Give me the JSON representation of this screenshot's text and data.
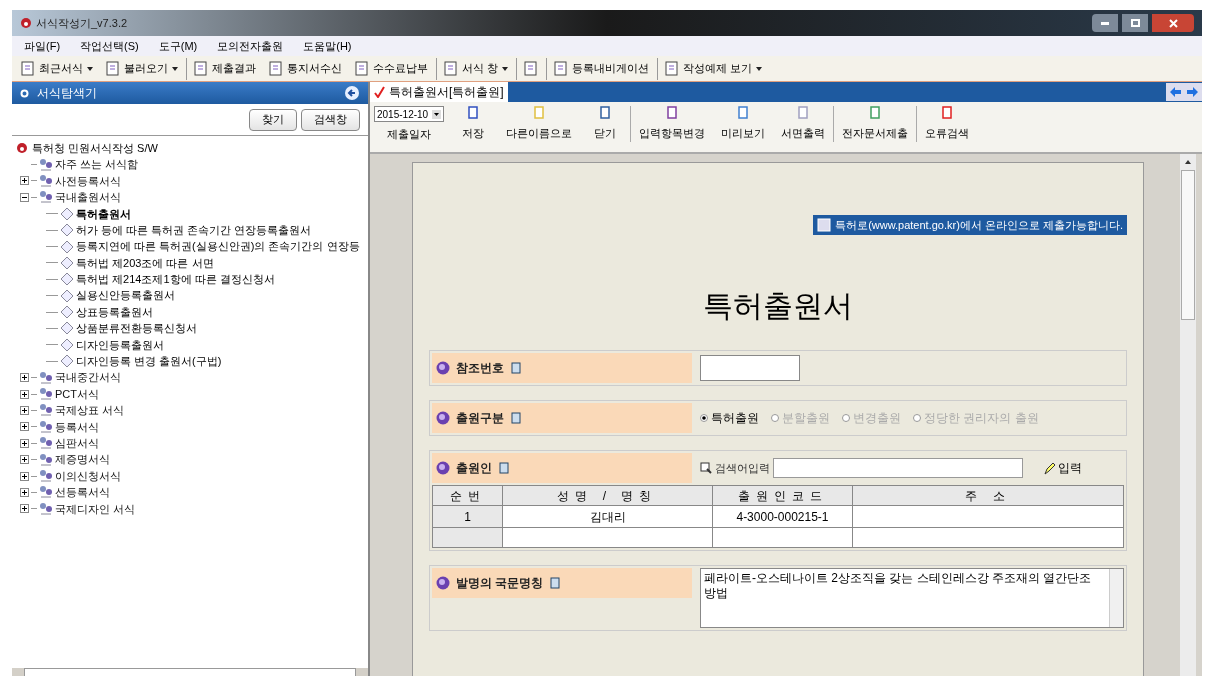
{
  "window": {
    "title": "서식작성기_v7.3.2"
  },
  "menu": [
    "파일(F)",
    "작업선택(S)",
    "도구(M)",
    "모의전자출원",
    "도움말(H)"
  ],
  "toolbar": [
    {
      "label": "최근서식",
      "dropdown": true,
      "separator_before": false
    },
    {
      "label": "불러오기",
      "dropdown": true,
      "separator_before": false
    },
    {
      "label": "제출결과",
      "dropdown": false,
      "separator_before": true
    },
    {
      "label": "통지서수신",
      "dropdown": false,
      "separator_before": false
    },
    {
      "label": "수수료납부",
      "dropdown": false,
      "separator_before": false
    },
    {
      "label": "서식 창",
      "dropdown": true,
      "separator_before": true
    },
    {
      "dropdown": false,
      "separator_before": true
    },
    {
      "label": "등록내비게이션",
      "dropdown": false,
      "separator_before": true
    },
    {
      "label": "작성예제 보기",
      "dropdown": true,
      "separator_before": true
    }
  ],
  "sidebar": {
    "title": "서식탐색기",
    "buttons": [
      "찾기",
      "검색창"
    ],
    "tree": {
      "label": "특허청 민원서식작성 S/W",
      "children": [
        {
          "label": "자주 쓰는 서식함",
          "expandable": false
        },
        {
          "label": "사전등록서식",
          "expandable": true,
          "expanded": false
        },
        {
          "label": "국내출원서식",
          "expandable": true,
          "expanded": true,
          "children": [
            {
              "label": "특허출원서",
              "selected": true
            },
            {
              "label": "허가 등에 따른 특허권 존속기간 연장등록출원서",
              "selected": false
            },
            {
              "label": "등록지연에 따른 특허권(실용신안권)의 존속기간의 연장등",
              "selected": false
            },
            {
              "label": "특허법 제203조에 따른 서면",
              "selected": false
            },
            {
              "label": "특허법 제214조제1항에 따른 결정신청서",
              "selected": false
            },
            {
              "label": "실용신안등록출원서",
              "selected": false
            },
            {
              "label": "상표등록출원서",
              "selected": false
            },
            {
              "label": "상품분류전환등록신청서",
              "selected": false
            },
            {
              "label": "디자인등록출원서",
              "selected": false
            },
            {
              "label": "디자인등록 변경 출원서(구법)",
              "selected": false
            }
          ]
        },
        {
          "label": "국내중간서식",
          "expandable": true,
          "expanded": false
        },
        {
          "label": "PCT서식",
          "expandable": true,
          "expanded": false
        },
        {
          "label": "국제상표 서식",
          "expandable": true,
          "expanded": false
        },
        {
          "label": "등록서식",
          "expandable": true,
          "expanded": false
        },
        {
          "label": "심판서식",
          "expandable": true,
          "expanded": false
        },
        {
          "label": "제증명서식",
          "expandable": true,
          "expanded": false
        },
        {
          "label": "이의신청서식",
          "expandable": true,
          "expanded": false
        },
        {
          "label": "선등록서식",
          "expandable": true,
          "expanded": false
        },
        {
          "label": "국제디자인 서식",
          "expandable": true,
          "expanded": false
        }
      ]
    }
  },
  "document": {
    "tab": "특허출원서[특허출원]",
    "date": {
      "value": "2015-12-10",
      "label": "제출일자"
    },
    "actions": [
      {
        "label": "저장",
        "separator_before": false
      },
      {
        "label": "다른이름으로",
        "separator_before": false
      },
      {
        "label": "닫기",
        "separator_before": false
      },
      {
        "label": "입력항목변경",
        "separator_before": true
      },
      {
        "label": "미리보기",
        "separator_before": false
      },
      {
        "label": "서면출력",
        "separator_before": false
      },
      {
        "label": "전자문서제출",
        "separator_before": true
      },
      {
        "label": "오류검색",
        "separator_before": true
      }
    ],
    "notice": "특허로(www.patent.go.kr)에서 온라인으로 제출가능합니다.",
    "heading": "특허출원서",
    "sections": [
      {
        "kind": "input",
        "label": "참조번호"
      },
      {
        "kind": "radio",
        "label": "출원구분",
        "options": [
          {
            "label": "특허출원",
            "selected": true,
            "disabled": false
          },
          {
            "label": "분할출원",
            "selected": false,
            "disabled": true
          },
          {
            "label": "변경출원",
            "selected": false,
            "disabled": true
          },
          {
            "label": "정당한 권리자의 출원",
            "selected": false,
            "disabled": true
          }
        ]
      },
      {
        "kind": "table",
        "label": "출원인",
        "search_label": "검색어입력",
        "button": "입력",
        "columns": [
          "순번",
          "성명 / 명칭",
          "출원인코드",
          "주 소"
        ],
        "rows": [
          [
            "1",
            "김대리",
            "4-3000-000215-1"
          ]
        ]
      },
      {
        "kind": "textarea",
        "label": "발명의 국문명칭",
        "value": "페라이트-오스테나이트 2상조직을 갖는 스테인레스강 주조재의 열간단조 방법"
      }
    ]
  }
}
